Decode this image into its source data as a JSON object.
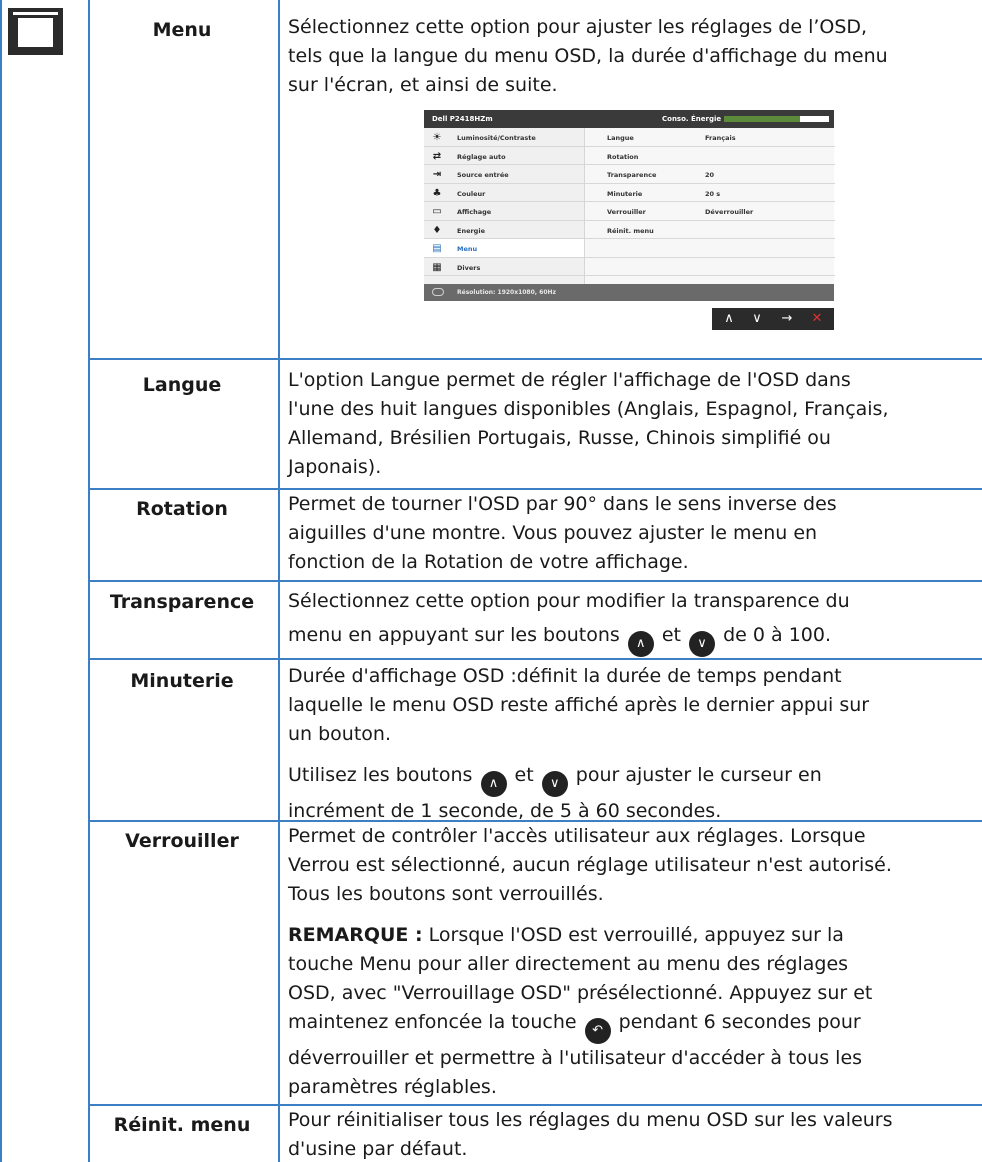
{
  "rows": [
    {
      "label": "Menu",
      "desc": [
        "Sélectionnez cette option pour ajuster les réglages de l’OSD,",
        "tels que la langue du menu OSD, la durée d'affichage du menu",
        "sur l'écran, et ainsi de suite."
      ]
    },
    {
      "label": "Langue",
      "desc": [
        "L'option Langue permet de régler l'affichage de l'OSD dans",
        "l'une des huit langues disponibles (Anglais, Espagnol, Français,",
        "Allemand, Brésilien Portugais, Russe, Chinois simplifié ou",
        "Japonais)."
      ]
    },
    {
      "label": "Rotation",
      "desc": [
        "Permet de tourner l'OSD par 90° dans le sens inverse des",
        "aiguilles d'une montre. Vous pouvez ajuster le menu en",
        "fonction de la Rotation de votre affichage."
      ]
    },
    {
      "label": "Transparence",
      "desc_line1": "Sélectionnez cette option pour modifier la transparence du",
      "desc_a": "menu en appuyant sur les boutons",
      "desc_b": "et",
      "desc_c": "de 0 à 100."
    },
    {
      "label": "Minuterie",
      "desc": [
        "Durée d'affichage OSD :définit la durée de temps pendant",
        "laquelle le menu OSD reste affiché après le dernier appui sur",
        "un bouton."
      ],
      "desc2_a": "Utilisez les boutons",
      "desc2_b": "et",
      "desc2_c": "pour ajuster le curseur en",
      "desc2_line2": "incrément de 1 seconde, de 5 à 60 secondes."
    },
    {
      "label": "Verrouiller",
      "desc": [
        "Permet de contrôler l'accès utilisateur aux réglages. Lorsque",
        "Verrou est sélectionné, aucun réglage utilisateur n'est autorisé.",
        "Tous les boutons sont verrouillés."
      ],
      "note_label": "REMARQUE :",
      "note_line1": "Lorsque l'OSD est verrouillé, appuyez sur la",
      "note_lines": [
        "touche Menu pour aller directement au menu des réglages",
        "OSD, avec \"Verrouillage OSD\" présélectionné. Appuyez sur et"
      ],
      "note_c": "maintenez enfoncée la touche",
      "note_d": "pendant 6 secondes pour",
      "note_tail": [
        "déverrouiller et permettre à l'utilisateur d'accéder à tous les",
        "paramètres réglables."
      ]
    },
    {
      "label": "Réinit. menu",
      "desc": [
        "Pour réinitialiser tous les réglages du menu OSD sur les valeurs",
        "d'usine par défaut."
      ]
    }
  ],
  "icons": {
    "section": "menu-window-icon",
    "up": "chevron-up-icon",
    "down": "chevron-down-icon",
    "back": "back-arrow-icon"
  },
  "osd": {
    "model": "Dell P2418HZm",
    "energy_label": "Conso. Énergie",
    "energy_level": 0.72,
    "menu_items": [
      {
        "label": "Luminosité/Contraste",
        "icon": "sun-icon",
        "glyph": "☀"
      },
      {
        "label": "Réglage auto",
        "icon": "auto-adjust-icon",
        "glyph": "⇄"
      },
      {
        "label": "Source entrée",
        "icon": "input-source-icon",
        "glyph": "⇥"
      },
      {
        "label": "Couleur",
        "icon": "color-icon",
        "glyph": "♣"
      },
      {
        "label": "Affichage",
        "icon": "display-icon",
        "glyph": "▭"
      },
      {
        "label": "Energie",
        "icon": "energy-icon",
        "glyph": "♦"
      },
      {
        "label": "Menu",
        "icon": "menu-icon",
        "glyph": "▤"
      },
      {
        "label": "Divers",
        "icon": "others-icon",
        "glyph": "▦"
      }
    ],
    "settings": [
      {
        "key": "Langue",
        "value": "Français"
      },
      {
        "key": "Rotation",
        "value": ""
      },
      {
        "key": "Transparence",
        "value": "20"
      },
      {
        "key": "Minuterie",
        "value": "20 s"
      },
      {
        "key": "Verrouiller",
        "value": "Déverrouiller"
      },
      {
        "key": "Réinit. menu",
        "value": ""
      }
    ],
    "resolution": "Résolution: 1920x1080, 60Hz",
    "nav": [
      "∧",
      "∨",
      "→",
      "✕"
    ],
    "colors": {
      "selected": "#2a6fc0",
      "close": "#e03030",
      "energy_fill": "#5a8a3a"
    }
  },
  "table_color": "#3b7fc4"
}
